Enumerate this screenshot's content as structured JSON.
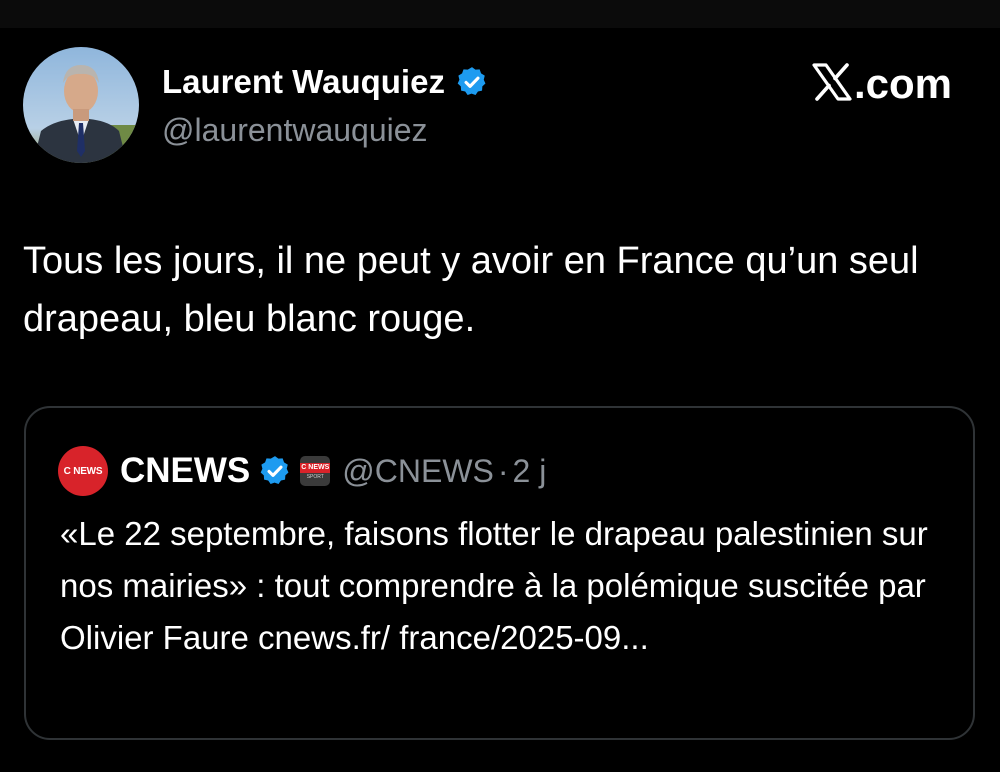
{
  "author": {
    "name": "Laurent Wauquiez",
    "handle": "@laurentwauquiez",
    "verified_color": "#1d9bf0"
  },
  "brand": {
    "logo_icon": "x-logo-icon",
    "text": ".com"
  },
  "tweet": {
    "text": "Tous les jours, il ne peut y avoir en France qu’un seul drapeau, bleu blanc rouge."
  },
  "quoted": {
    "avatar_text": "C NEWS",
    "name": "CNEWS",
    "affiliate_badge": {
      "main": "C NEWS",
      "sub": "SPORT"
    },
    "handle": "@CNEWS",
    "separator": "·",
    "time": "2 j",
    "text": "«Le 22 septembre, faisons flotter le drapeau palestinien sur nos mairies» : tout comprendre à la polémique suscitée par Olivier Faure cnews.fr/ france/2025-09..."
  },
  "colors": {
    "background": "#000000",
    "text": "#ffffff",
    "secondary": "#8b9198",
    "border": "#2f3336",
    "cnews_red": "#d8232a"
  }
}
